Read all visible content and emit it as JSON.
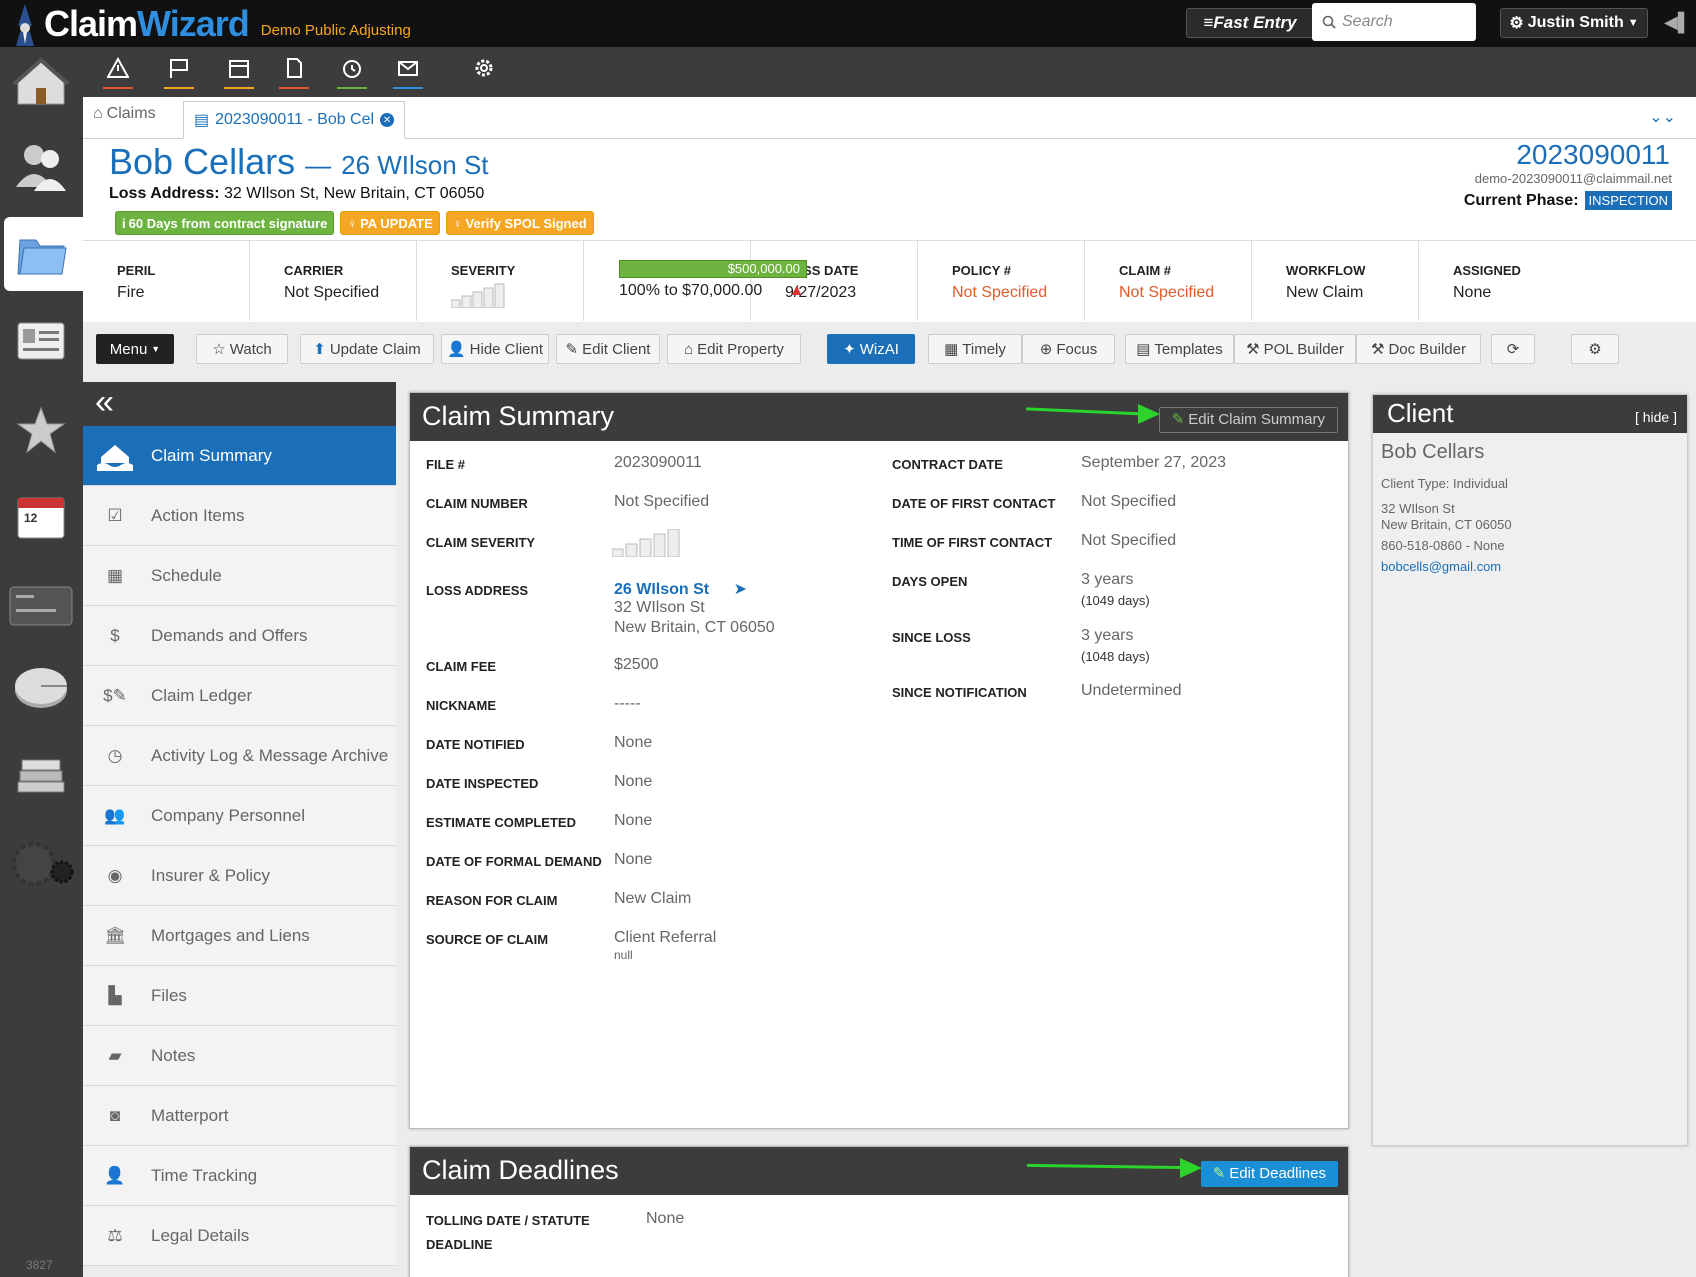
{
  "app": {
    "brand_a": "Claim",
    "brand_b": "Wizard",
    "company": "Demo Public Adjusting"
  },
  "topbar": {
    "fast_entry": "Fast Entry",
    "search_placeholder": "Search",
    "user": "Justin Smith"
  },
  "rail": {
    "version": "3827"
  },
  "tabs": {
    "claims": "Claims",
    "claim_tab": "2023090011 - Bob Cel"
  },
  "header": {
    "client_name": "Bob Cellars",
    "dash": "—",
    "street": "26 WIlson St",
    "loss_label": "Loss Address:",
    "loss_address": "32 WIlson St, New Britain, CT 06050",
    "file_number": "2023090011",
    "email": "demo-2023090011@claimmail.net",
    "phase_label": "Current Phase:",
    "phase": "INSPECTION",
    "badges": [
      "60 Days from contract signature",
      "PA UPDATE",
      "Verify SPOL Signed"
    ]
  },
  "stats": {
    "peril": {
      "label": "PERIL",
      "value": "Fire"
    },
    "carrier": {
      "label": "CARRIER",
      "value": "Not Specified"
    },
    "severity": {
      "label": "SEVERITY"
    },
    "money_bar": "$500,000.00",
    "money_text": "100% to $70,000.00",
    "loss_date": {
      "label": "LOSS DATE",
      "value": "9/27/2023"
    },
    "policy": {
      "label": "POLICY #",
      "value": "Not Specified"
    },
    "claim": {
      "label": "CLAIM #",
      "value": "Not Specified"
    },
    "workflow": {
      "label": "WORKFLOW",
      "value": "New Claim"
    },
    "assigned": {
      "label": "ASSIGNED",
      "value": "None"
    }
  },
  "toolbar": {
    "menu": "Menu",
    "watch": "Watch",
    "update_claim": "Update Claim",
    "hide_client": "Hide Client",
    "edit_client": "Edit Client",
    "edit_property": "Edit Property",
    "wizai": "WizAI",
    "timely": "Timely",
    "focus": "Focus",
    "templates": "Templates",
    "pol_builder": "POL Builder",
    "doc_builder": "Doc Builder"
  },
  "sidenav": [
    "Claim Summary",
    "Action Items",
    "Schedule",
    "Demands and Offers",
    "Claim Ledger",
    "Activity Log & Message Archive",
    "Company Personnel",
    "Insurer & Policy",
    "Mortgages and Liens",
    "Files",
    "Notes",
    "Matterport",
    "Time Tracking",
    "Legal Details"
  ],
  "summary": {
    "title": "Claim Summary",
    "edit": "Edit Claim Summary",
    "file_label": "FILE #",
    "file": "2023090011",
    "claim_number_label": "CLAIM NUMBER",
    "claim_number": "Not Specified",
    "severity_label": "CLAIM SEVERITY",
    "loss_address_label": "LOSS ADDRESS",
    "loss_street": "26 WIlson St",
    "loss_line1": "32 WIlson St",
    "loss_line2": "New Britain, CT 06050",
    "fee_label": "CLAIM FEE",
    "fee": "$2500",
    "nickname_label": "NICKNAME",
    "nickname": "-----",
    "notified_label": "DATE NOTIFIED",
    "notified": "None",
    "inspected_label": "DATE INSPECTED",
    "inspected": "None",
    "estimate_label": "ESTIMATE COMPLETED",
    "estimate": "None",
    "formal_label": "DATE OF FORMAL DEMAND",
    "formal": "None",
    "reason_label": "REASON FOR CLAIM",
    "reason": "New Claim",
    "source_label": "SOURCE OF CLAIM",
    "source": "Client Referral",
    "source_sub": "null",
    "contract_label": "CONTRACT DATE",
    "contract": "September 27, 2023",
    "first_contact_label": "DATE OF FIRST CONTACT",
    "first_contact": "Not Specified",
    "time_contact_label": "TIME OF FIRST CONTACT",
    "time_contact": "Not Specified",
    "days_open_label": "DAYS OPEN",
    "days_open": "3 years",
    "days_open_sub": "(1049 days)",
    "since_loss_label": "SINCE LOSS",
    "since_loss": "3 years",
    "since_loss_sub": "(1048 days)",
    "since_notif_label": "SINCE NOTIFICATION",
    "since_notif": "Undetermined"
  },
  "deadlines": {
    "title": "Claim Deadlines",
    "edit": "Edit Deadlines",
    "tolling_label_1": "TOLLING DATE / STATUTE",
    "tolling_label_2": "DEADLINE",
    "tolling": "None"
  },
  "client": {
    "title": "Client",
    "hide": "[ hide ]",
    "name": "Bob Cellars",
    "type": "Client Type: Individual",
    "addr1": "32 WIlson St",
    "addr2": "New Britain, CT 06050",
    "phone": "860-518-0860 - None",
    "email": "bobcells@gmail.com"
  },
  "colors": {
    "accent": "#1a6fb8",
    "dark": "#3c3c3c",
    "badge_green": "#6db33f",
    "badge_orange": "#f5a623",
    "warn": "#e05a2a",
    "arrow": "#2bd32b"
  }
}
